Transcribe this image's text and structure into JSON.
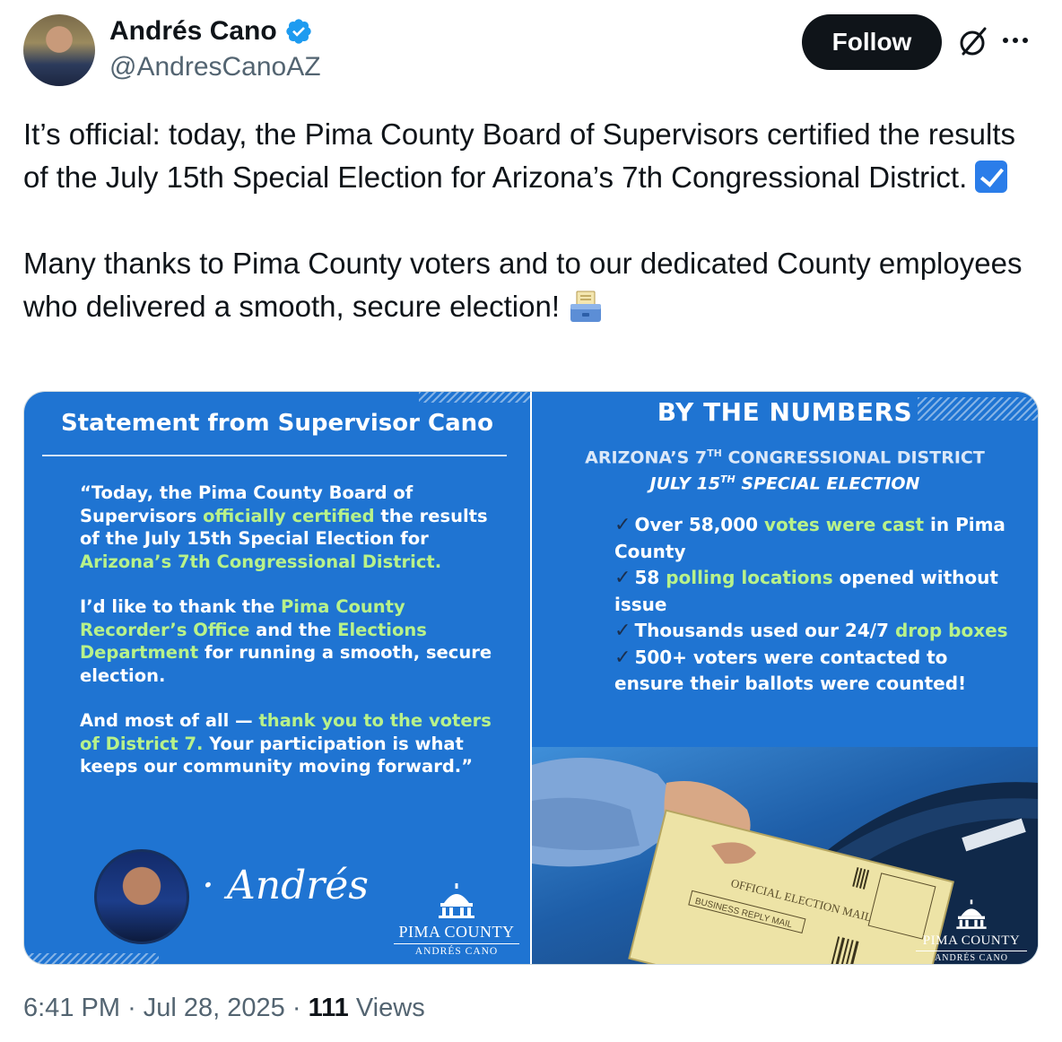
{
  "author": {
    "name": "Andrés Cano",
    "handle": "@AndresCanoAZ"
  },
  "actions": {
    "follow_label": "Follow"
  },
  "tweet": {
    "paragraph1": "It’s official: today, the Pima County Board of Supervisors certified the results of the July 15th Special Election for Arizona’s 7th Congressional District.",
    "paragraph2": "Many thanks to Pima County voters and to our dedicated County employees who delivered a smooth, secure election!"
  },
  "media": {
    "left": {
      "title": "Statement from Supervisor Cano",
      "q1": [
        {
          "t": "“Today, the Pima County Board of Supervisors ",
          "hl": false
        },
        {
          "t": "officially certified",
          "hl": true
        },
        {
          "t": " the results of the July 15th Special Election for ",
          "hl": false
        },
        {
          "t": "Arizona’s 7th Congressional District.",
          "hl": true
        }
      ],
      "q2": [
        {
          "t": "I’d like to thank the ",
          "hl": false
        },
        {
          "t": "Pima County Recorder’s Office",
          "hl": true
        },
        {
          "t": " and the ",
          "hl": false
        },
        {
          "t": "Elections Department",
          "hl": true
        },
        {
          "t": " for running a smooth, secure election.",
          "hl": false
        }
      ],
      "q3": [
        {
          "t": "And most of all — ",
          "hl": false
        },
        {
          "t": "thank you to the voters of District 7.",
          "hl": true
        },
        {
          "t": " Your participation is what keeps our community moving forward.”",
          "hl": false
        }
      ],
      "signature": "· Andrés",
      "logo_name": "PIMA COUNTY",
      "logo_sub": "ANDRÉS CANO"
    },
    "right": {
      "title": "BY THE NUMBERS",
      "sub1_pre": "ARIZONA’S 7",
      "sub1_sup": "TH",
      "sub1_post": " CONGRESSIONAL DISTRICT",
      "sub2_pre": "JULY 15",
      "sub2_sup": "TH",
      "sub2_post": " SPECIAL ELECTION",
      "facts": [
        [
          {
            "t": "Over 58,000 ",
            "hl": false
          },
          {
            "t": "votes were cast",
            "hl": true
          },
          {
            "t": " in Pima County",
            "hl": false
          }
        ],
        [
          {
            "t": "58 ",
            "hl": false
          },
          {
            "t": "polling locations",
            "hl": true
          },
          {
            "t": " opened without issue",
            "hl": false
          }
        ],
        [
          {
            "t": "Thousands used our 24/7 ",
            "hl": false
          },
          {
            "t": "drop boxes",
            "hl": true
          }
        ],
        [
          {
            "t": "500+ voters were contacted to ensure their ballots were counted!",
            "hl": false
          }
        ]
      ],
      "envelope_text": "OFFICIAL ELECTION MAIL",
      "reply_text": "BUSINESS REPLY MAIL",
      "logo_name": "PIMA COUNTY",
      "logo_sub": "ANDRÉS CANO"
    }
  },
  "meta": {
    "time": "6:41 PM",
    "sep": "·",
    "date": "Jul 28, 2025",
    "views_count": "111",
    "views_label": "Views"
  },
  "colors": {
    "panel_blue": "#1f74d2",
    "highlight_green": "#b8f28a",
    "verified_blue": "#1d9bf0"
  },
  "icons": [
    "verified-badge-icon",
    "grok-icon",
    "more-icon",
    "checkbox-emoji-icon",
    "ballot-box-emoji-icon",
    "capitol-dome-icon"
  ]
}
